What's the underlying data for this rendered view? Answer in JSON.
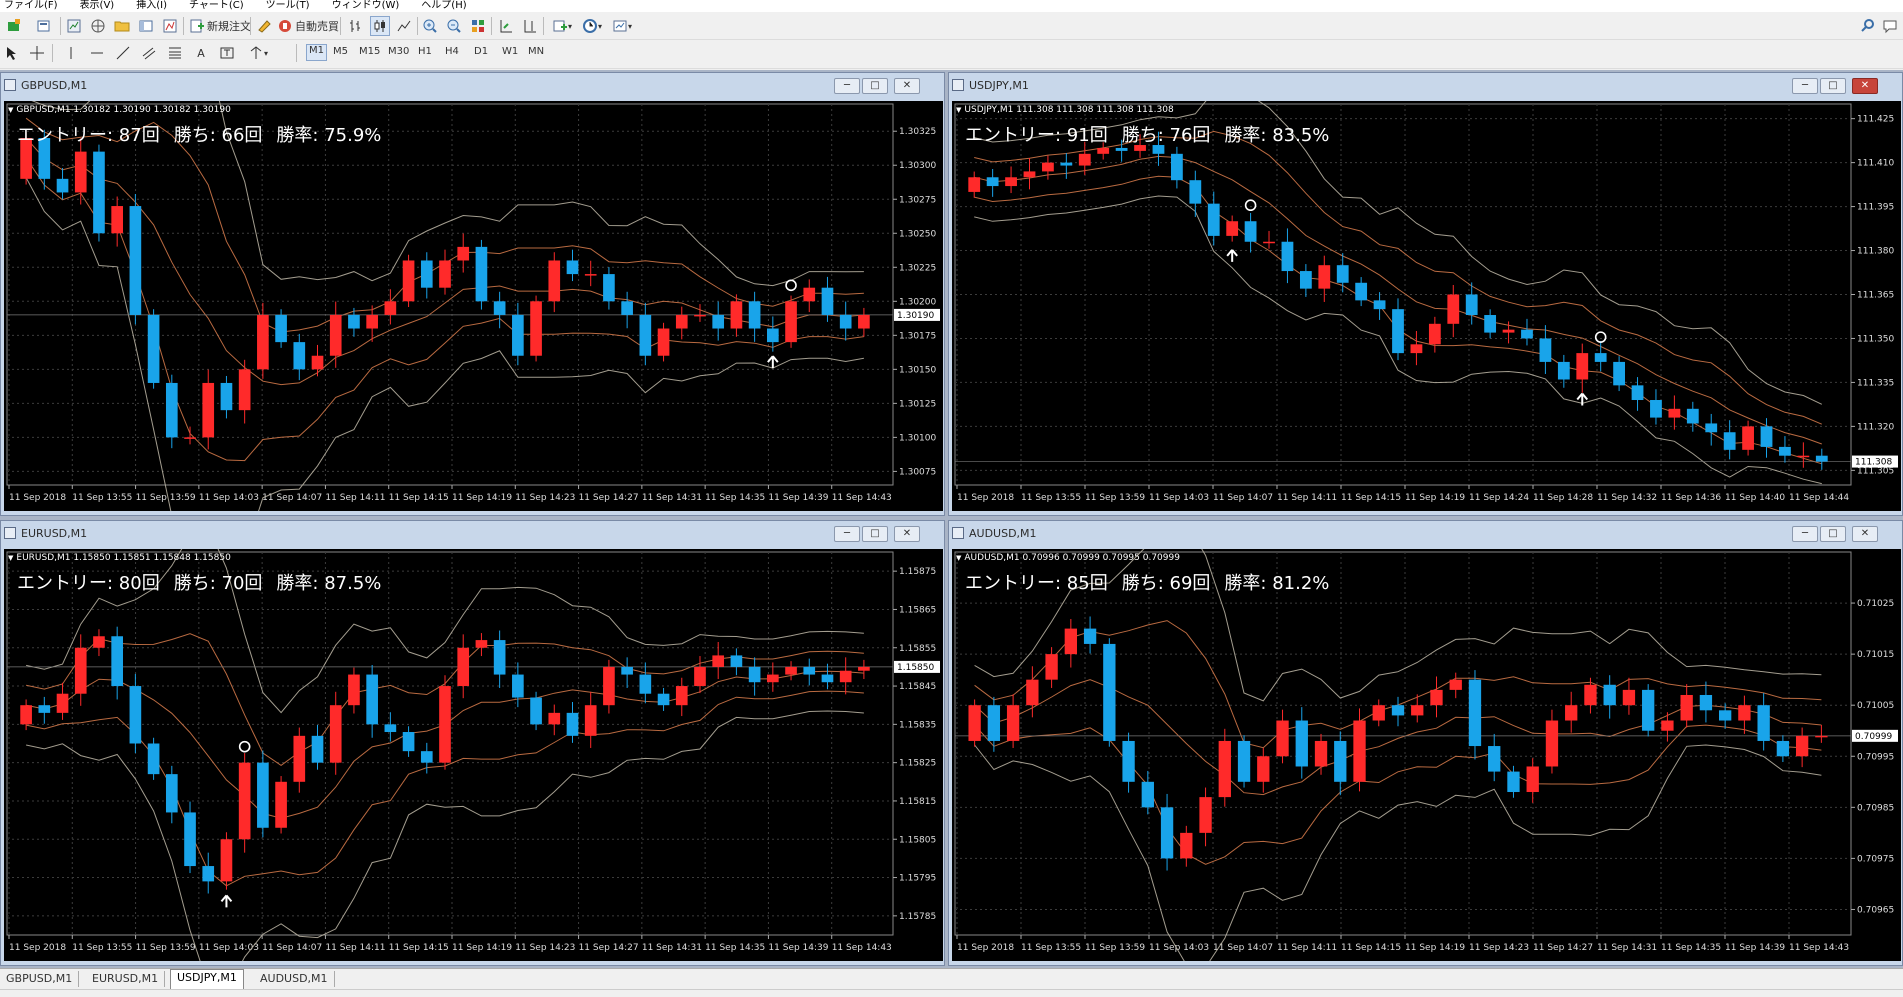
{
  "menu": [
    "ファイル(F)",
    "表示(V)",
    "挿入(I)",
    "チャート(C)",
    "ツール(T)",
    "ウィンドウ(W)",
    "ヘルプ(H)"
  ],
  "toolbar": {
    "new_order": "新規注文",
    "auto_trade": "自動売買"
  },
  "timeframes": [
    "M1",
    "M5",
    "M15",
    "M30",
    "H1",
    "H4",
    "D1",
    "W1",
    "MN"
  ],
  "tabs": [
    "GBPUSD,M1",
    "EURUSD,M1",
    "USDJPY,M1",
    "AUDUSD,M1"
  ],
  "active_tab": "USDJPY,M1",
  "colors": {
    "bull": "#ff2a2a",
    "bear": "#19a4ea",
    "band_outer": "#c0b8a8",
    "band_inner": "#d97c4c",
    "grid": "#3c3c3c",
    "chart_bg": "#000000"
  },
  "windows": [
    {
      "title": "GBPUSD,M1",
      "symbol_line": "GBPUSD,M1  1.30182 1.30190 1.30182 1.30190",
      "stats": {
        "entries": "エントリー: 87回",
        "wins": "勝ち: 66回",
        "rate": "勝率: 75.9%"
      },
      "price_labels": [
        "1.30325",
        "1.30300",
        "1.30275",
        "1.30250",
        "1.30225",
        "1.30200",
        "1.30175",
        "1.30150",
        "1.30125",
        "1.30100",
        "1.30075"
      ],
      "current_price": "1.30190",
      "time_labels": [
        "11 Sep 2018",
        "11 Sep 13:55",
        "11 Sep 13:59",
        "11 Sep 14:03",
        "11 Sep 14:07",
        "11 Sep 14:11",
        "11 Sep 14:15",
        "11 Sep 14:19",
        "11 Sep 14:23",
        "11 Sep 14:27",
        "11 Sep 14:31",
        "11 Sep 14:35",
        "11 Sep 14:39",
        "11 Sep 14:43"
      ]
    },
    {
      "title": "USDJPY,M1",
      "symbol_line": "USDJPY,M1  111.308 111.308 111.308 111.308",
      "stats": {
        "entries": "エントリー: 91回",
        "wins": "勝ち: 76回",
        "rate": "勝率: 83.5%"
      },
      "price_labels": [
        "111.425",
        "111.410",
        "111.395",
        "111.380",
        "111.365",
        "111.350",
        "111.335",
        "111.320",
        "111.305"
      ],
      "current_price": "111.308",
      "time_labels": [
        "11 Sep 2018",
        "11 Sep 13:55",
        "11 Sep 13:59",
        "11 Sep 14:03",
        "11 Sep 14:07",
        "11 Sep 14:11",
        "11 Sep 14:15",
        "11 Sep 14:19",
        "11 Sep 14:24",
        "11 Sep 14:28",
        "11 Sep 14:32",
        "11 Sep 14:36",
        "11 Sep 14:40",
        "11 Sep 14:44"
      ]
    },
    {
      "title": "EURUSD,M1",
      "symbol_line": "EURUSD,M1  1.15850 1.15851 1.15848 1.15850",
      "stats": {
        "entries": "エントリー: 80回",
        "wins": "勝ち: 70回",
        "rate": "勝率: 87.5%"
      },
      "price_labels": [
        "1.15875",
        "1.15865",
        "1.15855",
        "1.15845",
        "1.15835",
        "1.15825",
        "1.15815",
        "1.15805",
        "1.15795",
        "1.15785"
      ],
      "current_price": "1.15850",
      "time_labels": [
        "11 Sep 2018",
        "11 Sep 13:55",
        "11 Sep 13:59",
        "11 Sep 14:03",
        "11 Sep 14:07",
        "11 Sep 14:11",
        "11 Sep 14:15",
        "11 Sep 14:19",
        "11 Sep 14:23",
        "11 Sep 14:27",
        "11 Sep 14:31",
        "11 Sep 14:35",
        "11 Sep 14:39",
        "11 Sep 14:43"
      ]
    },
    {
      "title": "AUDUSD,M1",
      "symbol_line": "AUDUSD,M1  0.70996 0.70999 0.70995 0.70999",
      "stats": {
        "entries": "エントリー: 85回",
        "wins": "勝ち: 69回",
        "rate": "勝率: 81.2%"
      },
      "price_labels": [
        "0.71025",
        "0.71015",
        "0.71005",
        "0.70995",
        "0.70985",
        "0.70975",
        "0.70965"
      ],
      "current_price": "0.70999",
      "time_labels": [
        "11 Sep 2018",
        "11 Sep 13:55",
        "11 Sep 13:59",
        "11 Sep 14:03",
        "11 Sep 14:07",
        "11 Sep 14:11",
        "11 Sep 14:15",
        "11 Sep 14:19",
        "11 Sep 14:23",
        "11 Sep 14:27",
        "11 Sep 14:31",
        "11 Sep 14:35",
        "11 Sep 14:39",
        "11 Sep 14:43"
      ]
    }
  ],
  "chart_data": [
    {
      "type": "candlestick",
      "symbol": "GBPUSD,M1",
      "ylim": [
        1.30065,
        1.30345
      ],
      "current": 1.3019,
      "open": [
        1.3029,
        1.3032,
        1.3029,
        1.3028,
        1.3031,
        1.3025,
        1.3027,
        1.3019,
        1.3014,
        1.301,
        1.301,
        1.3014,
        1.3012,
        1.3015,
        1.3019,
        1.3017,
        1.3015,
        1.3016,
        1.3019,
        1.3018,
        1.3019,
        1.302,
        1.3023,
        1.3021,
        1.3023,
        1.3024,
        1.302,
        1.3019,
        1.3016,
        1.302,
        1.3023,
        1.3022,
        1.3022,
        1.302,
        1.3019,
        1.3016,
        1.3018,
        1.3019,
        1.3019,
        1.3018,
        1.302,
        1.3018,
        1.3017,
        1.302,
        1.3021,
        1.3019,
        1.3018
      ],
      "close": [
        1.3032,
        1.3029,
        1.3028,
        1.3031,
        1.3025,
        1.3027,
        1.3019,
        1.3014,
        1.301,
        1.301,
        1.3014,
        1.3012,
        1.3015,
        1.3019,
        1.3017,
        1.3015,
        1.3016,
        1.3019,
        1.3018,
        1.3019,
        1.302,
        1.3023,
        1.3021,
        1.3023,
        1.3024,
        1.302,
        1.3019,
        1.3016,
        1.302,
        1.3023,
        1.3022,
        1.3022,
        1.302,
        1.3019,
        1.3016,
        1.3018,
        1.3019,
        1.3019,
        1.3018,
        1.302,
        1.3018,
        1.3017,
        1.302,
        1.3021,
        1.3019,
        1.3018,
        1.3019
      ],
      "markers": [
        {
          "type": "buy-arrow",
          "index": 41
        },
        {
          "type": "circle",
          "index": 42
        }
      ]
    },
    {
      "type": "candlestick",
      "symbol": "USDJPY,M1",
      "ylim": [
        111.3,
        111.43
      ],
      "current": 111.308,
      "open": [
        111.4,
        111.405,
        111.402,
        111.405,
        111.407,
        111.41,
        111.409,
        111.413,
        111.415,
        111.414,
        111.416,
        111.413,
        111.404,
        111.396,
        111.385,
        111.39,
        111.383,
        111.383,
        111.373,
        111.367,
        111.375,
        111.369,
        111.363,
        111.36,
        111.345,
        111.348,
        111.355,
        111.365,
        111.358,
        111.352,
        111.353,
        111.35,
        111.342,
        111.336,
        111.345,
        111.342,
        111.334,
        111.329,
        111.323,
        111.326,
        111.321,
        111.318,
        111.312,
        111.32,
        111.313,
        111.31,
        111.31
      ],
      "close": [
        111.405,
        111.402,
        111.405,
        111.407,
        111.41,
        111.409,
        111.413,
        111.415,
        111.414,
        111.416,
        111.413,
        111.404,
        111.396,
        111.385,
        111.39,
        111.383,
        111.383,
        111.373,
        111.367,
        111.375,
        111.369,
        111.363,
        111.36,
        111.345,
        111.348,
        111.355,
        111.365,
        111.358,
        111.352,
        111.353,
        111.35,
        111.342,
        111.336,
        111.345,
        111.342,
        111.334,
        111.329,
        111.323,
        111.326,
        111.321,
        111.318,
        111.312,
        111.32,
        111.313,
        111.31,
        111.31,
        111.308
      ],
      "markers": [
        {
          "type": "buy-arrow",
          "index": 14
        },
        {
          "type": "circle",
          "index": 15
        },
        {
          "type": "buy-arrow",
          "index": 33
        },
        {
          "type": "circle",
          "index": 34
        }
      ]
    },
    {
      "type": "candlestick",
      "symbol": "EURUSD,M1",
      "ylim": [
        1.1578,
        1.1588
      ],
      "current": 1.1585,
      "open": [
        1.15835,
        1.1584,
        1.15838,
        1.15843,
        1.15855,
        1.15858,
        1.15845,
        1.1583,
        1.15822,
        1.15812,
        1.15798,
        1.15794,
        1.15805,
        1.15825,
        1.15808,
        1.1582,
        1.15832,
        1.15825,
        1.1584,
        1.15848,
        1.15835,
        1.15833,
        1.15828,
        1.15825,
        1.15845,
        1.15855,
        1.15857,
        1.15848,
        1.15842,
        1.15835,
        1.15838,
        1.15832,
        1.1584,
        1.1585,
        1.15848,
        1.15843,
        1.1584,
        1.15845,
        1.1585,
        1.15853,
        1.1585,
        1.15846,
        1.15848,
        1.1585,
        1.15848,
        1.15846,
        1.15849
      ],
      "close": [
        1.1584,
        1.15838,
        1.15843,
        1.15855,
        1.15858,
        1.15845,
        1.1583,
        1.15822,
        1.15812,
        1.15798,
        1.15794,
        1.15805,
        1.15825,
        1.15808,
        1.1582,
        1.15832,
        1.15825,
        1.1584,
        1.15848,
        1.15835,
        1.15833,
        1.15828,
        1.15825,
        1.15845,
        1.15855,
        1.15857,
        1.15848,
        1.15842,
        1.15835,
        1.15838,
        1.15832,
        1.1584,
        1.1585,
        1.15848,
        1.15843,
        1.1584,
        1.15845,
        1.1585,
        1.15853,
        1.1585,
        1.15846,
        1.15848,
        1.1585,
        1.15848,
        1.15846,
        1.15849,
        1.1585
      ],
      "markers": [
        {
          "type": "buy-arrow",
          "index": 11
        },
        {
          "type": "circle",
          "index": 12
        }
      ]
    },
    {
      "type": "candlestick",
      "symbol": "AUDUSD,M1",
      "ylim": [
        0.7096,
        0.71035
      ],
      "current": 0.70999,
      "open": [
        0.70998,
        0.71005,
        0.70998,
        0.71005,
        0.7101,
        0.71015,
        0.7102,
        0.71017,
        0.70998,
        0.7099,
        0.70985,
        0.70975,
        0.7098,
        0.70987,
        0.70998,
        0.7099,
        0.70995,
        0.71002,
        0.70993,
        0.70998,
        0.7099,
        0.71002,
        0.71005,
        0.71003,
        0.71005,
        0.71008,
        0.7101,
        0.70997,
        0.70992,
        0.70988,
        0.70993,
        0.71002,
        0.71005,
        0.71009,
        0.71005,
        0.71008,
        0.71,
        0.71002,
        0.71007,
        0.71004,
        0.71002,
        0.71005,
        0.70998,
        0.70995,
        0.70999
      ],
      "close": [
        0.71005,
        0.70998,
        0.71005,
        0.7101,
        0.71015,
        0.7102,
        0.71017,
        0.70998,
        0.7099,
        0.70985,
        0.70975,
        0.7098,
        0.70987,
        0.70998,
        0.7099,
        0.70995,
        0.71002,
        0.70993,
        0.70998,
        0.7099,
        0.71002,
        0.71005,
        0.71003,
        0.71005,
        0.71008,
        0.7101,
        0.70997,
        0.70992,
        0.70988,
        0.70993,
        0.71002,
        0.71005,
        0.71009,
        0.71005,
        0.71008,
        0.71,
        0.71002,
        0.71007,
        0.71004,
        0.71002,
        0.71005,
        0.70998,
        0.70995,
        0.70999,
        0.70999
      ],
      "markers": []
    }
  ]
}
